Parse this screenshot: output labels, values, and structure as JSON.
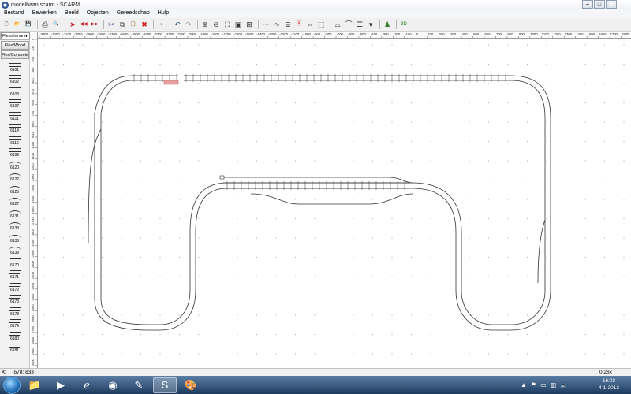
{
  "window": {
    "title": "modelbaan.scarm - SCARM",
    "controls": {
      "minimize": "–",
      "maximize": "□",
      "close": "✕"
    }
  },
  "menu": [
    "Bestand",
    "Bewerken",
    "Beeld",
    "Objecten",
    "Gereedschap",
    "Hulp"
  ],
  "toolbar": [
    {
      "name": "new-file-icon",
      "glyph": "🗋",
      "color": "#333"
    },
    {
      "name": "open-folder-icon",
      "glyph": "📂",
      "color": "#c89b2a"
    },
    {
      "name": "save-icon",
      "glyph": "💾",
      "color": "#2b4d8c"
    },
    {
      "sep": true
    },
    {
      "name": "print-icon",
      "glyph": "⎙",
      "color": "#444"
    },
    {
      "name": "print-preview-icon",
      "glyph": "🔍",
      "color": "#444"
    },
    {
      "sep": true
    },
    {
      "name": "arrow-right-icon",
      "glyph": "➤",
      "color": "#c0202a"
    },
    {
      "name": "arrow-left-double-icon",
      "glyph": "◀◀",
      "color": "#c0202a"
    },
    {
      "name": "arrow-right-double-icon",
      "glyph": "▶▶",
      "color": "#c0202a"
    },
    {
      "sep": true
    },
    {
      "name": "cut-icon",
      "glyph": "✂",
      "color": "#3a5fa8"
    },
    {
      "name": "copy-icon",
      "glyph": "⧉",
      "color": "#444"
    },
    {
      "name": "paste-icon",
      "glyph": "📋",
      "color": "#8a6a2a"
    },
    {
      "name": "delete-icon",
      "glyph": "✖",
      "color": "#d02020"
    },
    {
      "sep": true
    },
    {
      "name": "rotate-icon",
      "glyph": "◔",
      "color": "#2b4d8c"
    },
    {
      "sep": true
    },
    {
      "name": "undo-icon",
      "glyph": "↶",
      "color": "#2b4d8c"
    },
    {
      "name": "redo-icon",
      "glyph": "↷",
      "color": "#999"
    },
    {
      "sep": true
    },
    {
      "name": "zoom-in-icon",
      "glyph": "⊕",
      "color": "#333"
    },
    {
      "name": "zoom-out-icon",
      "glyph": "⊖",
      "color": "#333"
    },
    {
      "name": "zoom-fit-icon",
      "glyph": "⛶",
      "color": "#333"
    },
    {
      "name": "zoom-window-icon",
      "glyph": "▣",
      "color": "#333"
    },
    {
      "name": "zoom-all-icon",
      "glyph": "⊞",
      "color": "#333"
    },
    {
      "sep": true
    },
    {
      "name": "track-icon",
      "glyph": "⋯",
      "color": "#777"
    },
    {
      "name": "flex-track-icon",
      "glyph": "∿",
      "color": "#777"
    },
    {
      "name": "layer-icon",
      "glyph": "≣",
      "color": "#333"
    },
    {
      "name": "red-signal-icon",
      "glyph": "🅁",
      "color": "#d02020"
    },
    {
      "name": "measure-icon",
      "glyph": "⇔",
      "color": "#333"
    },
    {
      "name": "select-icon",
      "glyph": "⬚",
      "color": "#555"
    },
    {
      "sep": true
    },
    {
      "name": "bridge-icon",
      "glyph": "⌓",
      "color": "#333"
    },
    {
      "name": "tunnel-icon",
      "glyph": "⌒",
      "color": "#333"
    },
    {
      "name": "grid-icon",
      "glyph": "☰",
      "color": "#333"
    },
    {
      "name": "dropdown-icon",
      "glyph": "▾",
      "color": "#333"
    },
    {
      "sep": true
    },
    {
      "name": "3d-figure-icon",
      "glyph": "♟",
      "color": "#3a7a2a"
    },
    {
      "sep": true
    },
    {
      "name": "3d-view-icon",
      "glyph": "3D",
      "color": "#1a8a1a"
    }
  ],
  "library": {
    "manufacturer": "Fleischmann",
    "unit": "mm",
    "tabs": [
      "Flex/Wood",
      "Flex/Concrete"
    ],
    "items": [
      {
        "label": "6101",
        "kind": "straight"
      },
      {
        "label": "6102",
        "kind": "straight"
      },
      {
        "label": "6103",
        "kind": "straight"
      },
      {
        "label": "6107",
        "kind": "straight"
      },
      {
        "label": "6111",
        "kind": "straight"
      },
      {
        "label": "6114",
        "kind": "straight"
      },
      {
        "label": "6116",
        "kind": "straight"
      },
      {
        "label": "6199",
        "kind": "straight"
      },
      {
        "label": "6120",
        "kind": "curve"
      },
      {
        "label": "6122",
        "kind": "curve"
      },
      {
        "label": "6125",
        "kind": "curve"
      },
      {
        "label": "6127",
        "kind": "curve"
      },
      {
        "label": "6131",
        "kind": "curve"
      },
      {
        "label": "6133",
        "kind": "curve"
      },
      {
        "label": "6138",
        "kind": "curve"
      },
      {
        "label": "6139",
        "kind": "curve"
      },
      {
        "label": "6170",
        "kind": "switch"
      },
      {
        "label": "6171",
        "kind": "switch"
      },
      {
        "label": "6172",
        "kind": "switch"
      },
      {
        "label": "6173",
        "kind": "switch"
      },
      {
        "label": "6178",
        "kind": "switch"
      },
      {
        "label": "6179",
        "kind": "switch"
      },
      {
        "label": "6180",
        "kind": "switch"
      },
      {
        "label": "6181",
        "kind": "switch"
      }
    ]
  },
  "ruler": {
    "horizontal": [
      "-3300",
      "-3200",
      "-3100",
      "-3000",
      "-2900",
      "-2800",
      "-2700",
      "-2600",
      "-2500",
      "-2400",
      "-2300",
      "-2200",
      "-2100",
      "-2000",
      "-1900",
      "-1800",
      "-1700",
      "-1600",
      "-1500",
      "-1400",
      "-1300",
      "-1200",
      "-1100",
      "-1000",
      "-900",
      "-800",
      "-700",
      "-600",
      "-500",
      "-400",
      "-300",
      "-200",
      "-100",
      "0",
      "100",
      "200",
      "300",
      "400",
      "500",
      "600",
      "700",
      "800",
      "900",
      "1000",
      "1100",
      "1200",
      "1300",
      "1400",
      "1500",
      "1600",
      "1700",
      "1800"
    ],
    "vertical": [
      "0",
      "100",
      "200",
      "300",
      "400",
      "500",
      "600",
      "700",
      "800",
      "900",
      "1000",
      "1100",
      "1200",
      "1300",
      "1400",
      "1500",
      "1600",
      "1700",
      "1800",
      "1900",
      "2000",
      "2100",
      "2200",
      "2300",
      "2400",
      "2500",
      "2600",
      "2700",
      "2800",
      "2900",
      "3000"
    ]
  },
  "status": {
    "coords": "-578; 833",
    "zoom": "0,26x"
  },
  "taskbar": {
    "apps": [
      {
        "name": "explorer-icon",
        "glyph": "📁",
        "active": false
      },
      {
        "name": "media-player-icon",
        "glyph": "▶",
        "active": false
      },
      {
        "name": "internet-explorer-icon",
        "glyph": "ℯ",
        "active": false
      },
      {
        "name": "chrome-icon",
        "glyph": "◉",
        "active": false
      },
      {
        "name": "tool-app-icon",
        "glyph": "✎",
        "active": false
      },
      {
        "name": "scarm-icon",
        "glyph": "S",
        "active": true
      },
      {
        "name": "paint-icon",
        "glyph": "🎨",
        "active": false
      }
    ],
    "clock_time": "16:03",
    "clock_date": "4-1-2013"
  },
  "colors": {
    "track": "#333333",
    "highlight": "#e8a0a0",
    "grid_dot": "#b0b0b0"
  }
}
